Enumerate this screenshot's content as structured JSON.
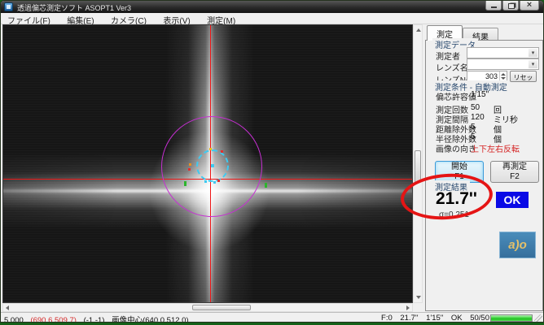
{
  "window": {
    "title": "透過偏芯測定ソフト ASOPT1 Ver3"
  },
  "menu": {
    "items": [
      "ファイル(F)",
      "編集(E)",
      "カメラ(C)",
      "表示(V)",
      "測定(M)"
    ]
  },
  "panel": {
    "tabs": {
      "measure": "測定",
      "result": "結果"
    },
    "data_group": {
      "title": "測定データ",
      "operator_label": "測定者",
      "lens_name_label": "レンズ名",
      "lens_no_label": "レンズNo.",
      "lens_no_value": "303",
      "reset_button": "リセット"
    },
    "conditions_group": {
      "title": "測定条件 - 自動測定",
      "rows": [
        {
          "label": "偏芯許容値",
          "value": "1'15\"",
          "unit": ""
        },
        {
          "label": "測定回数",
          "value": "50",
          "unit": "回"
        },
        {
          "label": "測定間隔",
          "value": "120",
          "unit": "ミリ秒"
        },
        {
          "label": "距離除外数",
          "value": "5",
          "unit": "個"
        },
        {
          "label": "半径除外数",
          "value": "5",
          "unit": "個"
        },
        {
          "label": "画像の向き",
          "value": "上下左右反転",
          "unit": ""
        }
      ]
    },
    "start_button": {
      "label": "開始",
      "key": "F1"
    },
    "remeasure_button": {
      "label": "再測定",
      "key": "F2"
    },
    "result_group": {
      "title": "測定結果",
      "value": "21.7''",
      "sigma": "σ=0.251",
      "judgement": "OK"
    },
    "logo_text": "a)o"
  },
  "statusbar": {
    "zoom": "5.000",
    "cursor_pos": "(690.6,509.7)",
    "grid_pos": "(-1,-1)",
    "image_center": "画像中心(640.0,512.0)",
    "frame": "F:0",
    "result": "21.7''",
    "tolerance": "1'15\"",
    "judgement": "OK",
    "count": "50/50"
  },
  "colors": {
    "crosshair": "#ee1515",
    "outer_circle": "#c62fd2",
    "point_circle": "#3fc9f0",
    "annotation": "#e51515",
    "ok_badge_bg": "#0a0ae6",
    "progress_fill": "#35cf35",
    "flip_warning_text": "#d41f1f"
  }
}
